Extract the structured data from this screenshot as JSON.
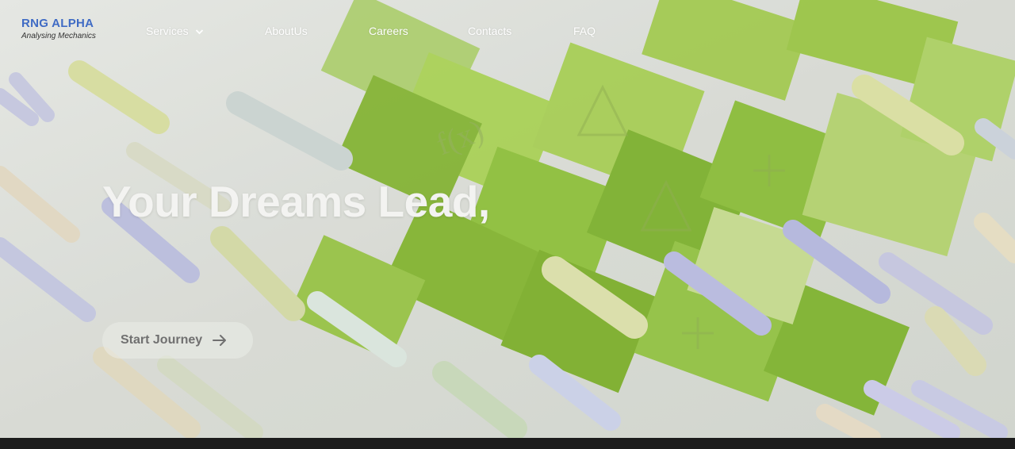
{
  "brand": {
    "name": "RNG ALPHA",
    "tagline": "Analysing Mechanics"
  },
  "nav": {
    "services": "Services",
    "about": "AboutUs",
    "careers": "Careers",
    "contacts": "Contacts",
    "faq": "FAQ"
  },
  "hero": {
    "headline": "Your Dreams Lead,",
    "cta_label": "Start Journey",
    "cta_icon": "arrow-right-icon"
  },
  "colors": {
    "brand": "#3f6bc4",
    "paper_green": "#8fc43a",
    "footer": "#1c1c1c"
  }
}
